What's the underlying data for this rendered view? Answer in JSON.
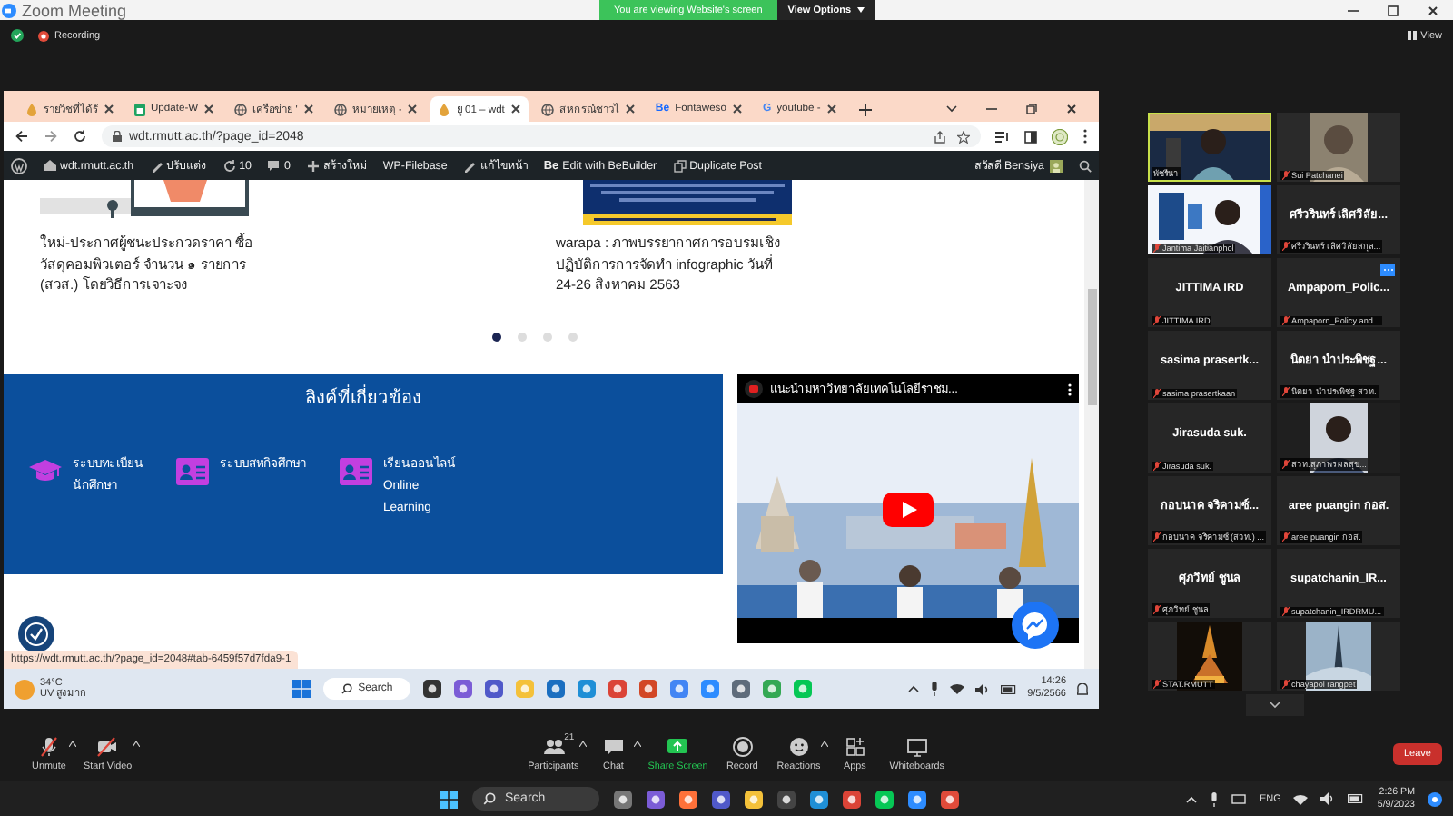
{
  "window": {
    "title": "Zoom Meeting"
  },
  "share_banner": {
    "text": "You are viewing Website's screen",
    "button": "View Options"
  },
  "meeting_bar": {
    "recording": "Recording",
    "view": "View"
  },
  "browser": {
    "tabs": [
      {
        "kind": "site",
        "label": "รายวิชที่ได้รั",
        "selected": false
      },
      {
        "kind": "sheets",
        "label": "Update-W",
        "selected": false
      },
      {
        "kind": "globe",
        "label": "เครือข่าย '",
        "selected": false
      },
      {
        "kind": "globe",
        "label": "หมายเหตุ -",
        "selected": false
      },
      {
        "kind": "site",
        "label": "ยู 01 – wdt",
        "selected": true
      },
      {
        "kind": "globe",
        "label": "สหกรณ์ชาวไ",
        "selected": false
      },
      {
        "kind": "behance",
        "logo": "Be",
        "label": "Fontaweso",
        "selected": false
      },
      {
        "kind": "google",
        "logo": "G",
        "label": "youtube - ",
        "selected": false
      }
    ],
    "address": "wdt.rmutt.ac.th/?page_id=2048",
    "admin_bar": {
      "site": "wdt.rmutt.ac.th",
      "items": [
        {
          "kind": "customize",
          "label": "ปรับแต่ง"
        },
        {
          "kind": "updates",
          "label": "10"
        },
        {
          "kind": "comments",
          "label": "0"
        },
        {
          "kind": "new",
          "label": "สร้างใหม่"
        },
        {
          "kind": "plain",
          "label": "WP-Filebase"
        },
        {
          "kind": "edit",
          "label": "แก้ไขหน้า"
        },
        {
          "kind": "logo",
          "logo": "Be",
          "label": "Edit with BeBuilder"
        },
        {
          "kind": "duplicate",
          "label": "Duplicate Post"
        }
      ],
      "greeting": "สวัสดี Bensiya"
    },
    "posts": [
      {
        "title": "ใหม่-ประกาศผู้ชนะประกวดราคา ซื้อวัสดุคอมพิวเตอร์ จำนวน ๑ รายการ (สวส.) โดยวิธีการเจาะจง"
      },
      {
        "title": "warapa : ภาพบรรยากาศการอบรมเชิงปฏิบัติการการจัดทำ infographic วันที่ 24-26 สิงหาคม 2563"
      }
    ],
    "carousel_dots": [
      {
        "selected": true
      },
      {
        "selected": false
      },
      {
        "selected": false
      },
      {
        "selected": false
      }
    ],
    "links_section": {
      "title": "ลิงค์ที่เกี่ยวข้อง",
      "links": [
        {
          "kind": "cap",
          "lines": [
            "ระบบทะเบียน",
            "นักศึกษา"
          ]
        },
        {
          "kind": "card",
          "lines": [
            "ระบบสหกิจศึกษา"
          ]
        },
        {
          "kind": "card",
          "lines": [
            "เรียนออนไลน์",
            "Online",
            "Learning"
          ]
        }
      ]
    },
    "video": {
      "title": "แนะนำมหาวิทยาลัยเทคโนโลยีราชม..."
    },
    "status_url": "https://wdt.rmutt.ac.th/?page_id=2048#tab-6459f57d7fda9-1",
    "taskbar": {
      "temperature": "34°C",
      "weather": "UV สูงมาก",
      "search": "Search",
      "time": "14:26",
      "date": "9/5/2566"
    }
  },
  "participants": [
    {
      "kind": "video",
      "name": "พัชรีนา",
      "muted": false,
      "selected": true,
      "hovered": false
    },
    {
      "kind": "video",
      "name": "Sui Patchanei",
      "muted": true,
      "selected": false,
      "hovered": false
    },
    {
      "kind": "video",
      "name": "Jantima Jaitianphol",
      "muted": true,
      "selected": false,
      "hovered": false
    },
    {
      "kind": "name",
      "display": "ศรีวรินทร์ เลิศวิลัย...",
      "name": "ศรีวรินทร์ เลิศวิลัยสกุล...",
      "muted": true,
      "selected": false,
      "hovered": false
    },
    {
      "kind": "name",
      "display": "JITTIMA IRD",
      "name": "JITTIMA IRD",
      "muted": true,
      "selected": false,
      "hovered": false
    },
    {
      "kind": "name",
      "display": "Ampaporn_Polic...",
      "name": "Ampaporn_Policy and...",
      "muted": true,
      "selected": false,
      "hovered": true
    },
    {
      "kind": "name",
      "display": "sasima prasertk...",
      "name": "sasima prasertkaan",
      "muted": true,
      "selected": false,
      "hovered": false
    },
    {
      "kind": "name",
      "display": "นิตยา นำประพิชฐ...",
      "name": "นิตยา นำประพิชฐ สวท.",
      "muted": true,
      "selected": false,
      "hovered": false
    },
    {
      "kind": "name",
      "display": "Jirasuda suk.",
      "name": "Jirasuda suk.",
      "muted": true,
      "selected": false,
      "hovered": false
    },
    {
      "kind": "video",
      "name": "สวท.สุภาพร ผลสุข...",
      "muted": true,
      "selected": false,
      "hovered": false
    },
    {
      "kind": "name",
      "display": "กอบนาค จริคามซ์...",
      "name": "กอบนาค จริคามซ์ (สวท.) ...",
      "muted": true,
      "selected": false,
      "hovered": false
    },
    {
      "kind": "name",
      "display": "aree puangin กอส.",
      "name": "aree puangin กอส.",
      "muted": true,
      "selected": false,
      "hovered": false
    },
    {
      "kind": "name",
      "display": "ศุภวิทย์ ชูนล",
      "name": "ศุภวิทย์ ชูนล",
      "muted": true,
      "selected": false,
      "hovered": false
    },
    {
      "kind": "name",
      "display": "supatchanin_IR...",
      "name": "supatchanin_IRDRMU...",
      "muted": true,
      "selected": false,
      "hovered": false
    },
    {
      "kind": "video",
      "name": "STAT.RMUTT",
      "muted": true,
      "selected": false,
      "hovered": false
    },
    {
      "kind": "video",
      "name": "chayapol rangpet",
      "muted": true,
      "selected": false,
      "hovered": false
    }
  ],
  "toolbar": {
    "buttons": [
      {
        "kind": "unmute",
        "label": "Unmute"
      },
      {
        "kind": "video",
        "label": "Start Video"
      },
      {
        "kind": "participants",
        "label": "Participants",
        "count": "21"
      },
      {
        "kind": "chat",
        "label": "Chat"
      },
      {
        "kind": "share",
        "label": "Share Screen"
      },
      {
        "kind": "record",
        "label": "Record"
      },
      {
        "kind": "reactions",
        "label": "Reactions"
      },
      {
        "kind": "apps",
        "label": "Apps"
      },
      {
        "kind": "whiteboards",
        "label": "Whiteboards"
      }
    ],
    "leave": "Leave"
  },
  "taskbar": {
    "search": "Search",
    "language": "ENG",
    "time": "2:26 PM",
    "date": "5/9/2023"
  }
}
